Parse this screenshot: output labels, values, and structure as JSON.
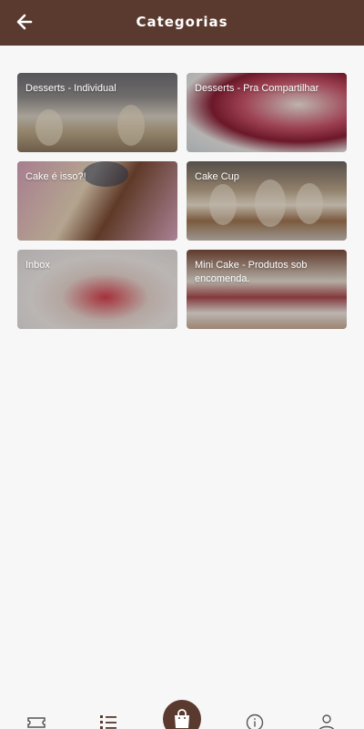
{
  "header": {
    "title": "Categorias",
    "back_icon": "arrow-left-icon"
  },
  "categories": [
    {
      "label": "Desserts - Individual"
    },
    {
      "label": "Desserts - Pra Compartilhar"
    },
    {
      "label": "Cake é isso?!"
    },
    {
      "label": "Cake Cup"
    },
    {
      "label": "Inbox"
    },
    {
      "label": "Mini Cake - Produtos sob encomenda."
    }
  ],
  "bottom_nav": {
    "items": [
      "ticket-icon",
      "list-icon",
      "shopping-bag-icon",
      "info-icon",
      "user-icon"
    ]
  },
  "colors": {
    "brand": "#5a3a2e",
    "background": "#f7f7f7",
    "text_on_brand": "#ffffff"
  }
}
